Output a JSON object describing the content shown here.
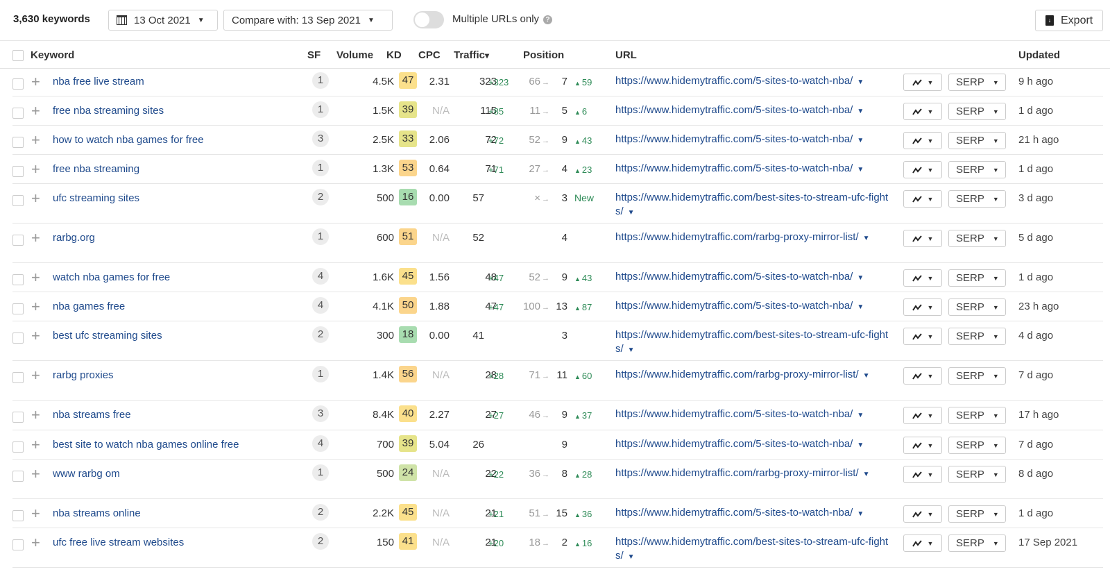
{
  "toolbar": {
    "keyword_count": "3,630 keywords",
    "date": "13 Oct 2021",
    "compare": "Compare with: 13 Sep 2021",
    "multiple_urls_label": "Multiple URLs only",
    "multiple_urls_on": false,
    "help_icon": "?",
    "export_label": "Export"
  },
  "columns": {
    "keyword": "Keyword",
    "sf": "SF",
    "volume": "Volume",
    "kd": "KD",
    "cpc": "CPC",
    "traffic": "Traffic",
    "traffic_sort": "▾",
    "position": "Position",
    "url": "URL",
    "updated": "Updated"
  },
  "kd_colors": {
    "green": "#a8dcb0",
    "light_green": "#cfe3a8",
    "yellow_green": "#e6e48a",
    "yellow": "#fbe08c",
    "orange": "#fbd58c"
  },
  "serp_label": "SERP",
  "rows": [
    {
      "keyword": "nba free live stream",
      "sf": "1",
      "volume": "4.5K",
      "kd": "47",
      "kd_color": "yellow",
      "cpc": "2.31",
      "traffic": "323",
      "traffic_delta": "+323",
      "pos_old": "66",
      "pos_new": "7",
      "pos_delta": "59",
      "url": "https://www.hidemytraffic.com/5-sites-to-watch-nba/",
      "updated": "9 h ago"
    },
    {
      "keyword": "free nba streaming sites",
      "sf": "1",
      "volume": "1.5K",
      "kd": "39",
      "kd_color": "yellow_green",
      "cpc": "N/A",
      "traffic": "115",
      "traffic_delta": "+85",
      "pos_old": "11",
      "pos_new": "5",
      "pos_delta": "6",
      "url": "https://www.hidemytraffic.com/5-sites-to-watch-nba/",
      "updated": "1 d ago"
    },
    {
      "keyword": "how to watch nba games for free",
      "sf": "3",
      "volume": "2.5K",
      "kd": "33",
      "kd_color": "yellow_green",
      "cpc": "2.06",
      "traffic": "72",
      "traffic_delta": "+72",
      "pos_old": "52",
      "pos_new": "9",
      "pos_delta": "43",
      "url": "https://www.hidemytraffic.com/5-sites-to-watch-nba/",
      "updated": "21 h ago"
    },
    {
      "keyword": "free nba streaming",
      "sf": "1",
      "volume": "1.3K",
      "kd": "53",
      "kd_color": "orange",
      "cpc": "0.64",
      "traffic": "71",
      "traffic_delta": "+71",
      "pos_old": "27",
      "pos_new": "4",
      "pos_delta": "23",
      "url": "https://www.hidemytraffic.com/5-sites-to-watch-nba/",
      "updated": "1 d ago"
    },
    {
      "keyword": "ufc streaming sites",
      "sf": "2",
      "volume": "500",
      "kd": "16",
      "kd_color": "green",
      "cpc": "0.00",
      "traffic": "57",
      "traffic_delta": "",
      "pos_old": "×",
      "pos_new": "3",
      "pos_delta": "",
      "pos_new_label": "New",
      "url": "https://www.hidemytraffic.com/best-sites-to-stream-ufc-fights/",
      "updated": "3 d ago"
    },
    {
      "keyword": "rarbg.org",
      "sf": "1",
      "volume": "600",
      "kd": "51",
      "kd_color": "orange",
      "cpc": "N/A",
      "traffic": "52",
      "traffic_delta": "",
      "pos_old": "",
      "pos_new": "4",
      "pos_delta": "",
      "url": "https://www.hidemytraffic.com/rarbg-proxy-mirror-list/",
      "updated": "5 d ago"
    },
    {
      "keyword": "watch nba games for free",
      "sf": "4",
      "volume": "1.6K",
      "kd": "45",
      "kd_color": "yellow",
      "cpc": "1.56",
      "traffic": "48",
      "traffic_delta": "+47",
      "pos_old": "52",
      "pos_new": "9",
      "pos_delta": "43",
      "url": "https://www.hidemytraffic.com/5-sites-to-watch-nba/",
      "updated": "1 d ago"
    },
    {
      "keyword": "nba games free",
      "sf": "4",
      "volume": "4.1K",
      "kd": "50",
      "kd_color": "orange",
      "cpc": "1.88",
      "traffic": "47",
      "traffic_delta": "+47",
      "pos_old": "100",
      "pos_new": "13",
      "pos_delta": "87",
      "url": "https://www.hidemytraffic.com/5-sites-to-watch-nba/",
      "updated": "23 h ago"
    },
    {
      "keyword": "best ufc streaming sites",
      "sf": "2",
      "volume": "300",
      "kd": "18",
      "kd_color": "green",
      "cpc": "0.00",
      "traffic": "41",
      "traffic_delta": "",
      "pos_old": "",
      "pos_new": "3",
      "pos_delta": "",
      "url": "https://www.hidemytraffic.com/best-sites-to-stream-ufc-fights/",
      "updated": "4 d ago"
    },
    {
      "keyword": "rarbg proxies",
      "sf": "1",
      "volume": "1.4K",
      "kd": "56",
      "kd_color": "orange",
      "cpc": "N/A",
      "traffic": "28",
      "traffic_delta": "+28",
      "pos_old": "71",
      "pos_new": "11",
      "pos_delta": "60",
      "url": "https://www.hidemytraffic.com/rarbg-proxy-mirror-list/",
      "updated": "7 d ago"
    },
    {
      "keyword": "nba streams free",
      "sf": "3",
      "volume": "8.4K",
      "kd": "40",
      "kd_color": "yellow",
      "cpc": "2.27",
      "traffic": "27",
      "traffic_delta": "+27",
      "pos_old": "46",
      "pos_new": "9",
      "pos_delta": "37",
      "url": "https://www.hidemytraffic.com/5-sites-to-watch-nba/",
      "updated": "17 h ago"
    },
    {
      "keyword": "best site to watch nba games online free",
      "sf": "4",
      "volume": "700",
      "kd": "39",
      "kd_color": "yellow_green",
      "cpc": "5.04",
      "traffic": "26",
      "traffic_delta": "",
      "pos_old": "",
      "pos_new": "9",
      "pos_delta": "",
      "url": "https://www.hidemytraffic.com/5-sites-to-watch-nba/",
      "updated": "7 d ago"
    },
    {
      "keyword": "www rarbg om",
      "sf": "1",
      "volume": "500",
      "kd": "24",
      "kd_color": "light_green",
      "cpc": "N/A",
      "traffic": "22",
      "traffic_delta": "+22",
      "pos_old": "36",
      "pos_new": "8",
      "pos_delta": "28",
      "url": "https://www.hidemytraffic.com/rarbg-proxy-mirror-list/",
      "updated": "8 d ago"
    },
    {
      "keyword": "nba streams online",
      "sf": "2",
      "volume": "2.2K",
      "kd": "45",
      "kd_color": "yellow",
      "cpc": "N/A",
      "traffic": "21",
      "traffic_delta": "+21",
      "pos_old": "51",
      "pos_new": "15",
      "pos_delta": "36",
      "url": "https://www.hidemytraffic.com/5-sites-to-watch-nba/",
      "updated": "1 d ago"
    },
    {
      "keyword": "ufc free live stream websites",
      "sf": "2",
      "volume": "150",
      "kd": "41",
      "kd_color": "yellow",
      "cpc": "N/A",
      "traffic": "21",
      "traffic_delta": "+20",
      "pos_old": "18",
      "pos_new": "2",
      "pos_delta": "16",
      "url": "https://www.hidemytraffic.com/best-sites-to-stream-ufc-fights/",
      "updated": "17 Sep 2021"
    }
  ]
}
